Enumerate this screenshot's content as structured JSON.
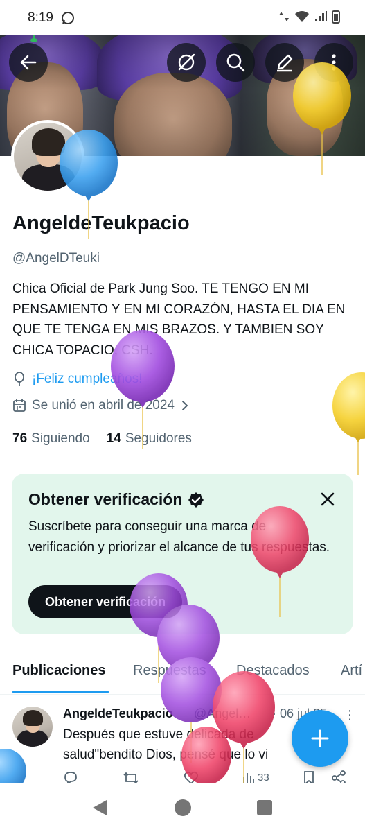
{
  "status_bar": {
    "time": "8:19"
  },
  "profile": {
    "display_name": "AngeldeTeukpacio",
    "handle": "@AngelDTeuki",
    "bio": "Chica Oficial de Park Jung Soo. TE TENGO EN MI PENSAMIENTO Y EN MI CORAZÓN, HASTA EL DIA EN QUE TE TENGA EN MIS BRAZOS. Y TAMBIEN SOY CHICA TOPACIO, CSH.",
    "birthday_text": "¡Feliz cumpleaños!",
    "joined_text": "Se unió en abril de 2024",
    "following_count": "76",
    "following_label": "Siguiendo",
    "followers_count": "14",
    "followers_label": "Seguidores"
  },
  "verification_card": {
    "title": "Obtener verificación",
    "text": "Suscríbete para conseguir una marca de verificación y priorizar el alcance de tus respuestas.",
    "button_label": "Obtener verificación"
  },
  "tabs": [
    {
      "label": "Publicaciones",
      "active": true
    },
    {
      "label": "Respuestas",
      "active": false
    },
    {
      "label": "Destacados",
      "active": false
    },
    {
      "label": "Artí",
      "active": false
    }
  ],
  "post": {
    "author_name": "AngeldeTeukpacio",
    "author_handle": "@Angel…",
    "date": "· 06 jul 25",
    "text": "Después que estuve delicada de salud\"bendito Dios, pensé que lo vi",
    "views": "33"
  },
  "colors": {
    "accent": "#1d9bf0",
    "text_primary": "#0f1419",
    "text_secondary": "#536471",
    "verify_card_bg": "#e2f6ec"
  },
  "icons": [
    "back-arrow-icon",
    "grok-icon",
    "search-icon",
    "edit-pencil-icon",
    "more-vertical-icon",
    "balloon-icon",
    "calendar-icon",
    "chevron-right-icon",
    "verified-badge-icon",
    "close-icon",
    "reply-icon",
    "repost-icon",
    "like-icon",
    "views-icon",
    "bookmark-icon",
    "share-icon",
    "plus-icon"
  ]
}
